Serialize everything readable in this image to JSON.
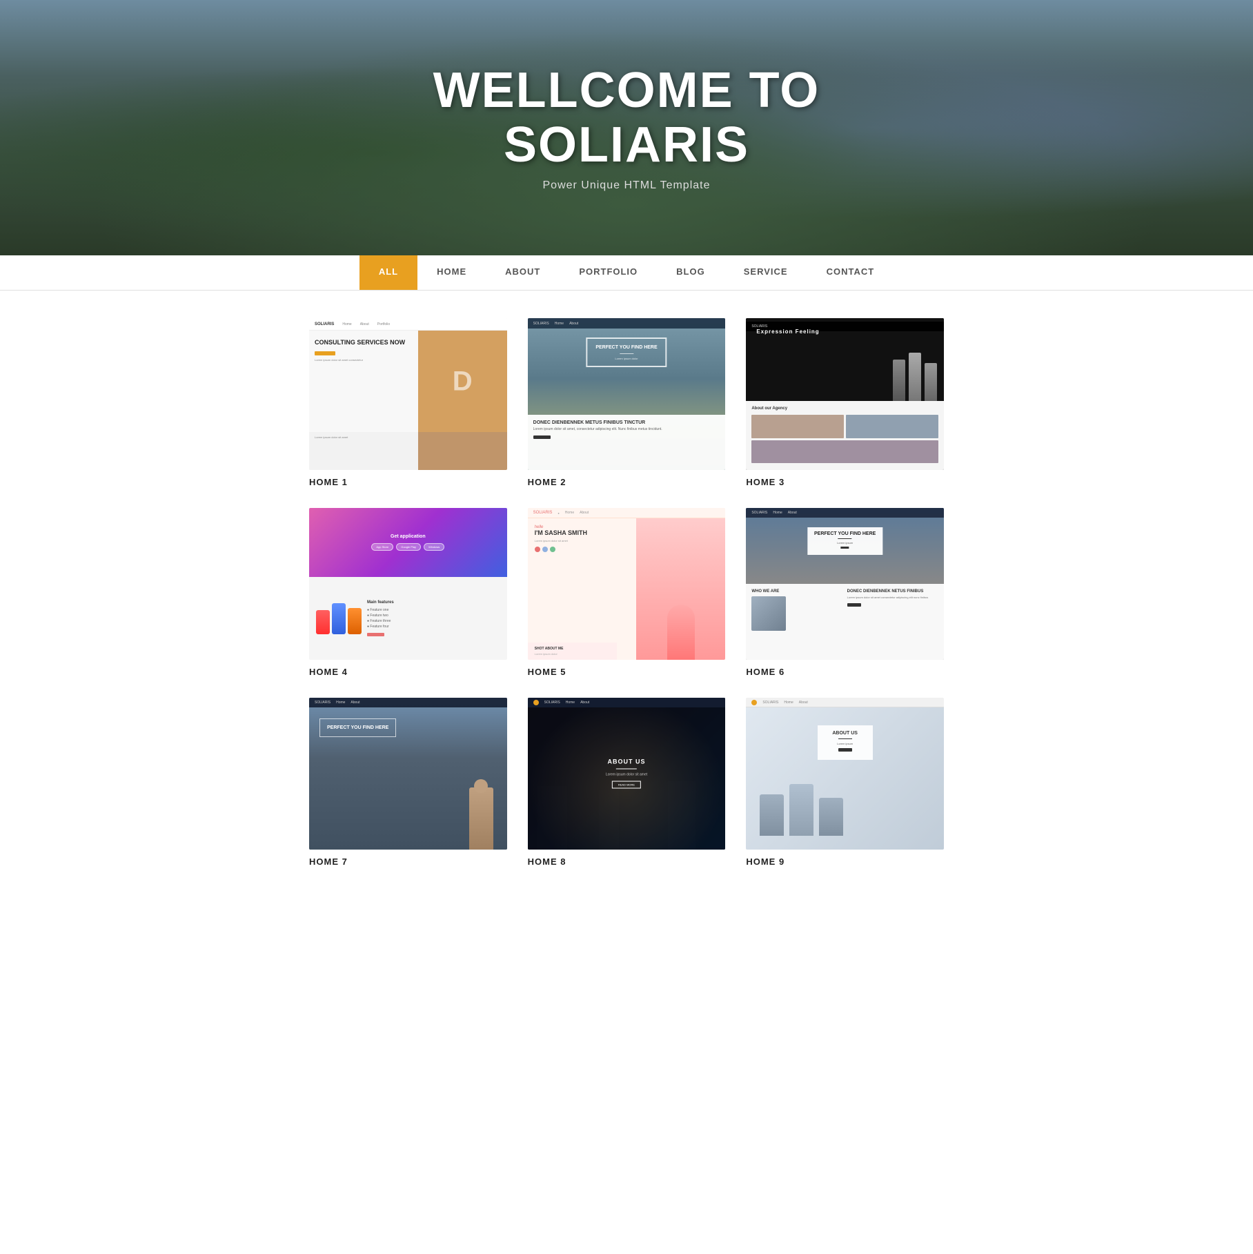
{
  "hero": {
    "title_line1": "WELLCOME TO",
    "title_line2": "SOLIARIS",
    "subtitle": "Power Unique HTML Template"
  },
  "filter_nav": {
    "items": [
      {
        "label": "ALL",
        "active": true
      },
      {
        "label": "HOME",
        "active": false
      },
      {
        "label": "ABOUT",
        "active": false
      },
      {
        "label": "PORTFOLIO",
        "active": false
      },
      {
        "label": "BLOG",
        "active": false
      },
      {
        "label": "SERVICE",
        "active": false
      },
      {
        "label": "CONTACT",
        "active": false
      }
    ]
  },
  "grid": {
    "items": [
      {
        "id": "home1",
        "label": "HOME 1"
      },
      {
        "id": "home2",
        "label": "HOME 2"
      },
      {
        "id": "home3",
        "label": "HOME 3"
      },
      {
        "id": "home4",
        "label": "HOME 4"
      },
      {
        "id": "home5",
        "label": "HOME 5"
      },
      {
        "id": "home6",
        "label": "HOME 6"
      },
      {
        "id": "home7",
        "label": "HOME 7"
      },
      {
        "id": "home8",
        "label": "HOME 8"
      },
      {
        "id": "home9",
        "label": "HOME 9"
      }
    ]
  },
  "thumb_texts": {
    "home1": {
      "nav_logo": "SOLIARIS",
      "consulting": "CONSULTING SERVICES NOW"
    },
    "home2": {
      "box_title": "PERFECT YOU FIND HERE",
      "lower_title": "DONEC DIENBENNEK METUS FINIBUS TINCTUR"
    },
    "home3": {
      "title": "Expression Feeling",
      "about": "About our Agency"
    },
    "home4": {
      "app_title": "Get application",
      "features": "Main features"
    },
    "home5": {
      "hello": "helle",
      "name": "I'M SASHA SMITH",
      "about": "SHOT ABOUT ME"
    },
    "home6": {
      "box_title": "PERFECT YOU FIND HERE",
      "who": "WHO WE ARE",
      "text_title": "DONEC DIENBENNEK NETUS FINIBUS"
    },
    "home7": {
      "box_title": "PERFECT YOU FIND HERE"
    },
    "home8": {
      "title": "ABOUT US"
    },
    "home9": {
      "title": "ABOUT US"
    }
  }
}
